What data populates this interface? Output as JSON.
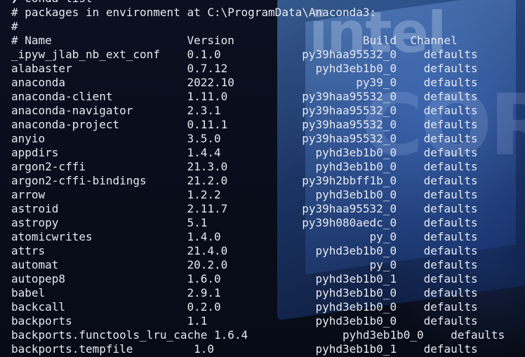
{
  "terminal": {
    "background_logo": {
      "brand": "intel",
      "tier": "CORE"
    },
    "lines": [
      "❯ conda list",
      "# packages in environment at C:\\ProgramData\\Anaconda3:",
      "#",
      "# Name                    Version                   Build  Channel",
      "_ipyw_jlab_nb_ext_conf    0.1.0            py39haa95532_0    defaults",
      "alabaster                 0.7.12             pyhd3eb1b0_0    defaults",
      "anaconda                  2022.10                  py39_0    defaults",
      "anaconda-client           1.11.0           py39haa95532_0    defaults",
      "anaconda-navigator        2.3.1            py39haa95532_0    defaults",
      "anaconda-project          0.11.1           py39haa95532_0    defaults",
      "anyio                     3.5.0            py39haa95532_0    defaults",
      "appdirs                   1.4.4              pyhd3eb1b0_0    defaults",
      "argon2-cffi               21.3.0             pyhd3eb1b0_0    defaults",
      "argon2-cffi-bindings      21.2.0           py39h2bbff1b_0    defaults",
      "arrow                     1.2.2              pyhd3eb1b0_0    defaults",
      "astroid                   2.11.7           py39haa95532_0    defaults",
      "astropy                   5.1              py39h080aedc_0    defaults",
      "atomicwrites              1.4.0                      py_0    defaults",
      "attrs                     21.4.0             pyhd3eb1b0_0    defaults",
      "automat                   20.2.0                     py_0    defaults",
      "autopep8                  1.6.0              pyhd3eb1b0_1    defaults",
      "babel                     2.9.1              pyhd3eb1b0_0    defaults",
      "backcall                  0.2.0              pyhd3eb1b0_0    defaults",
      "backports                 1.1                pyhd3eb1b0_0    defaults",
      "backports.functools_lru_cache 1.6.4              pyhd3eb1b0_0    defaults",
      "backports.tempfile         1.0               pyhd3eb1b0_1    defaults"
    ]
  }
}
